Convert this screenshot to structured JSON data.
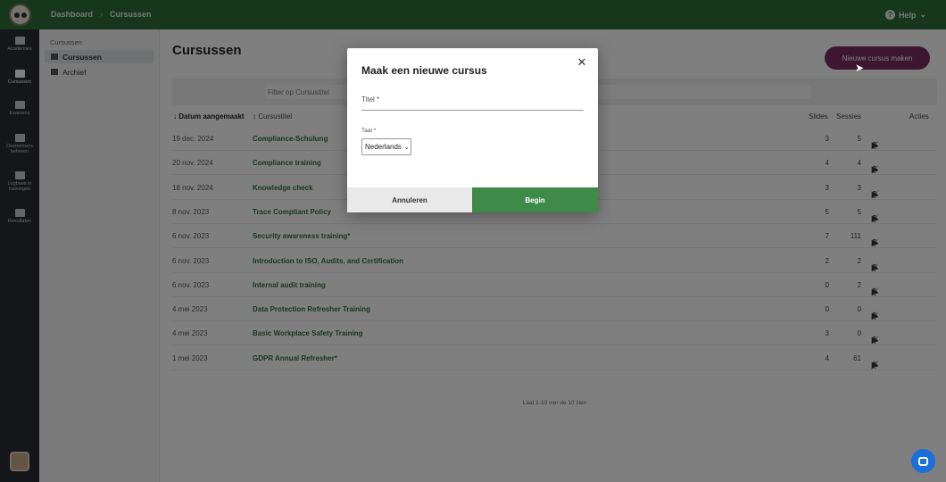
{
  "header": {
    "breadcrumb": [
      "Dashboard",
      "Cursussen"
    ],
    "breadcrumb_sep": "›",
    "help_label": "Help",
    "help_caret": "⌄"
  },
  "rail": {
    "items": [
      {
        "label": "Academies"
      },
      {
        "label": "Cursussen"
      },
      {
        "label": "Examens"
      },
      {
        "label": "Deelnemers beheren"
      },
      {
        "label": "Logboek in trainingen"
      },
      {
        "label": "Resultaten"
      }
    ],
    "active_index": 1
  },
  "subnav": {
    "heading": "Cursussen",
    "items": [
      {
        "label": "Cursussen"
      },
      {
        "label": "Archief"
      }
    ]
  },
  "page": {
    "title": "Cursussen",
    "new_button": "Nieuwe cursus maken",
    "filter_placeholder": "Filter op Cursustitel"
  },
  "table": {
    "columns": {
      "date": "↓ Datum aangemaakt",
      "title": "↕ Cursustitel",
      "slides": "Slides",
      "sessions": "Sessies",
      "actions": "Acties"
    },
    "rows": [
      {
        "date": "19 dec. 2024",
        "title": "Compliance-Schulung",
        "slides": "3",
        "sessions": "5"
      },
      {
        "date": "20 nov. 2024",
        "title": "Compliance training",
        "slides": "4",
        "sessions": "4"
      },
      {
        "date": "18 nov. 2024",
        "title": "Knowledge check",
        "slides": "3",
        "sessions": "3"
      },
      {
        "date": "8 nov. 2023",
        "title": "Trace Compliant Policy",
        "slides": "5",
        "sessions": "5"
      },
      {
        "date": "6 nov. 2023",
        "title": "Security awareness training*",
        "slides": "7",
        "sessions": "111"
      },
      {
        "date": "6 nov. 2023",
        "title": "Introduction to ISO, Audits, and Certification",
        "slides": "2",
        "sessions": "2"
      },
      {
        "date": "6 nov. 2023",
        "title": "Internal audit training",
        "slides": "0",
        "sessions": "2"
      },
      {
        "date": "4 mei 2023",
        "title": "Data Protection Refresher Training",
        "slides": "0",
        "sessions": "0"
      },
      {
        "date": "4 mei 2023",
        "title": "Basic Workplace Safety Training",
        "slides": "3",
        "sessions": "0"
      },
      {
        "date": "1 mei 2023",
        "title": "GDPR Annual Refresher*",
        "slides": "4",
        "sessions": "61"
      }
    ],
    "footer": "Laat 1-10 van de 10 zien"
  },
  "modal": {
    "title": "Maak een nieuwe cursus",
    "close_glyph": "✕",
    "title_field_label": "Titel *",
    "language_label": "Taal *",
    "language_value": "Nederlands",
    "cancel_label": "Annuleren",
    "begin_label": "Begin"
  },
  "colors": {
    "topbar": "#2f6f3a",
    "accent_button": "#7b2e63",
    "primary": "#3e8a49"
  }
}
